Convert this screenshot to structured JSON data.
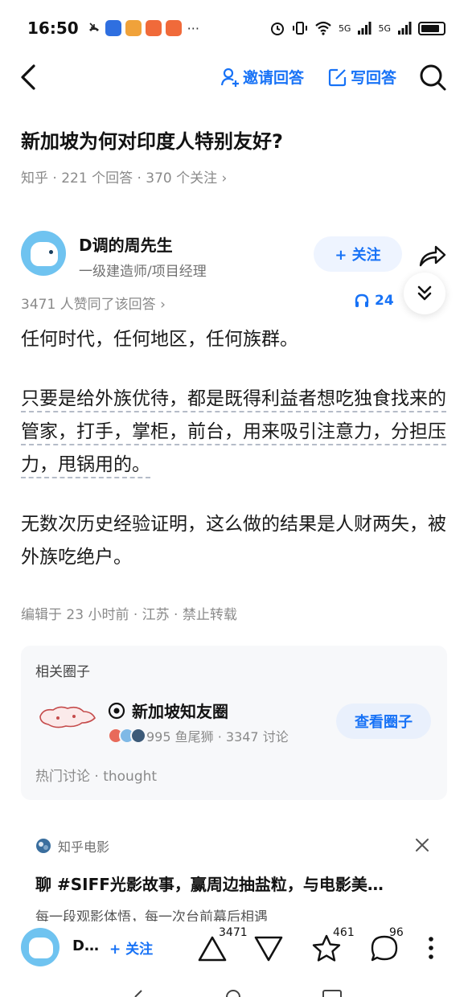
{
  "status_bar": {
    "time": "16:50",
    "network_labels": [
      "5G",
      "5G"
    ]
  },
  "nav": {
    "invite_label": "邀请回答",
    "write_label": "写回答"
  },
  "question": {
    "title": "新加坡为何对印度人特别友好?",
    "meta": "知乎 · 221 个回答 · 370 个关注 ›"
  },
  "author": {
    "name": "D调的周先生",
    "title": "一级建造师/项目经理",
    "follow_label": "+ 关注"
  },
  "votes_line": "3471 人赞同了该回答 ›",
  "listen_count": "24",
  "answer": {
    "paragraphs": [
      "任何时代，任何地区，任何族群。",
      "只要是给外族优待，都是既得利益者想吃独食找来的管家，打手，掌柜，前台，用来吸引注意力，分担压力，甩锅用的。",
      "无数次历史经验证明，这么做的结果是人财两失，被外族吃绝户。"
    ]
  },
  "edit_meta": "编辑于 23 小时前 · 江苏 · 禁止转载",
  "related_circle": {
    "heading": "相关圈子",
    "name": "新加坡知友圈",
    "stats": "995 鱼尾狮 · 3347 讨论",
    "view_label": "查看圈子",
    "hot_topics": "热门讨论 · thought"
  },
  "ad": {
    "source": "知乎电影",
    "title": "聊 #SIFF光影故事，赢周边抽盐粒，与电影美…",
    "description": "每一段观影体悟，每一次台前幕后相遇"
  },
  "bottom_bar": {
    "author_short": "D…",
    "follow_label": "+ 关注",
    "upvotes": "3471",
    "favorites": "461",
    "comments": "96"
  },
  "colors": {
    "accent": "#1772f6",
    "avatar": "#6fc3f0",
    "muted_text": "#8a8a8a"
  },
  "icons": [
    "back-arrow-icon",
    "invite-person-icon",
    "write-edit-icon",
    "search-icon",
    "share-icon",
    "expand-chevrons-icon",
    "headphones-icon",
    "circle-target-icon",
    "close-icon",
    "upvote-icon",
    "downvote-icon",
    "star-icon",
    "comment-icon",
    "more-icon"
  ]
}
